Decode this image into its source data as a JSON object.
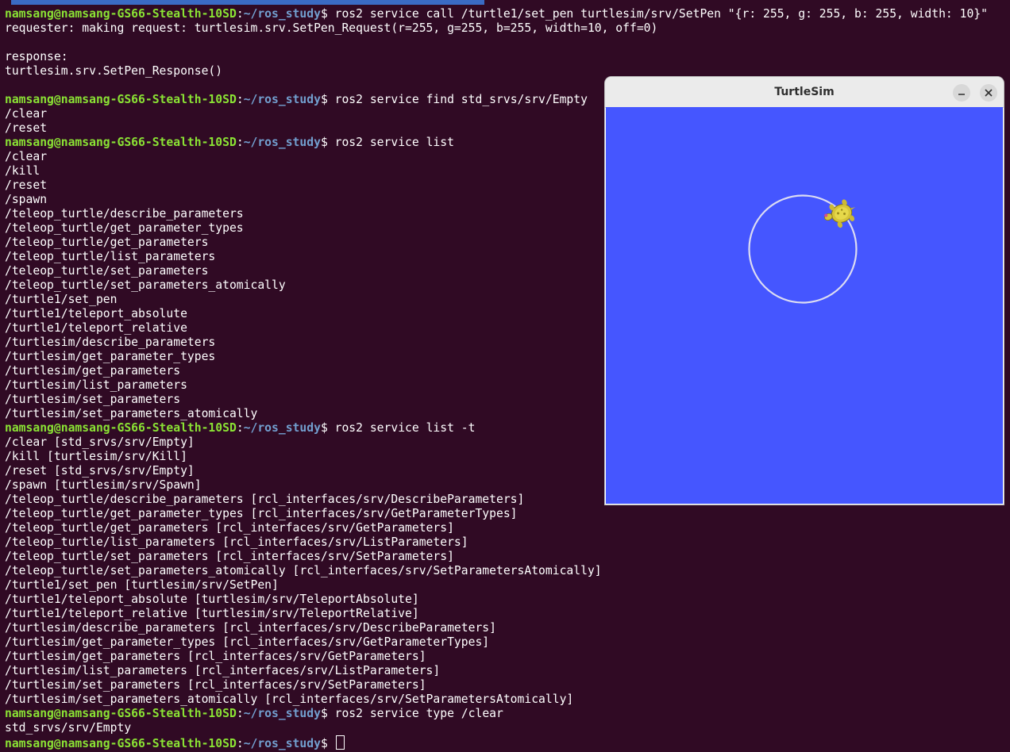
{
  "terminal": {
    "prompt_user": "namsang@namsang-GS66-Stealth-10SD",
    "prompt_path": "~/ros_study",
    "lines": [
      {
        "type": "cmd",
        "text": "ros2 service call /turtle1/set_pen turtlesim/srv/SetPen \"{r: 255, g: 255, b: 255, width: 10}\""
      },
      {
        "type": "out",
        "text": "requester: making request: turtlesim.srv.SetPen_Request(r=255, g=255, b=255, width=10, off=0)"
      },
      {
        "type": "out",
        "text": ""
      },
      {
        "type": "out",
        "text": "response:"
      },
      {
        "type": "out",
        "text": "turtlesim.srv.SetPen_Response()"
      },
      {
        "type": "out",
        "text": ""
      },
      {
        "type": "cmd",
        "text": "ros2 service find std_srvs/srv/Empty"
      },
      {
        "type": "out",
        "text": "/clear"
      },
      {
        "type": "out",
        "text": "/reset"
      },
      {
        "type": "cmd",
        "text": "ros2 service list"
      },
      {
        "type": "out",
        "text": "/clear"
      },
      {
        "type": "out",
        "text": "/kill"
      },
      {
        "type": "out",
        "text": "/reset"
      },
      {
        "type": "out",
        "text": "/spawn"
      },
      {
        "type": "out",
        "text": "/teleop_turtle/describe_parameters"
      },
      {
        "type": "out",
        "text": "/teleop_turtle/get_parameter_types"
      },
      {
        "type": "out",
        "text": "/teleop_turtle/get_parameters"
      },
      {
        "type": "out",
        "text": "/teleop_turtle/list_parameters"
      },
      {
        "type": "out",
        "text": "/teleop_turtle/set_parameters"
      },
      {
        "type": "out",
        "text": "/teleop_turtle/set_parameters_atomically"
      },
      {
        "type": "out",
        "text": "/turtle1/set_pen"
      },
      {
        "type": "out",
        "text": "/turtle1/teleport_absolute"
      },
      {
        "type": "out",
        "text": "/turtle1/teleport_relative"
      },
      {
        "type": "out",
        "text": "/turtlesim/describe_parameters"
      },
      {
        "type": "out",
        "text": "/turtlesim/get_parameter_types"
      },
      {
        "type": "out",
        "text": "/turtlesim/get_parameters"
      },
      {
        "type": "out",
        "text": "/turtlesim/list_parameters"
      },
      {
        "type": "out",
        "text": "/turtlesim/set_parameters"
      },
      {
        "type": "out",
        "text": "/turtlesim/set_parameters_atomically"
      },
      {
        "type": "cmd",
        "text": "ros2 service list -t"
      },
      {
        "type": "out",
        "text": "/clear [std_srvs/srv/Empty]"
      },
      {
        "type": "out",
        "text": "/kill [turtlesim/srv/Kill]"
      },
      {
        "type": "out",
        "text": "/reset [std_srvs/srv/Empty]"
      },
      {
        "type": "out",
        "text": "/spawn [turtlesim/srv/Spawn]"
      },
      {
        "type": "out",
        "text": "/teleop_turtle/describe_parameters [rcl_interfaces/srv/DescribeParameters]"
      },
      {
        "type": "out",
        "text": "/teleop_turtle/get_parameter_types [rcl_interfaces/srv/GetParameterTypes]"
      },
      {
        "type": "out",
        "text": "/teleop_turtle/get_parameters [rcl_interfaces/srv/GetParameters]"
      },
      {
        "type": "out",
        "text": "/teleop_turtle/list_parameters [rcl_interfaces/srv/ListParameters]"
      },
      {
        "type": "out",
        "text": "/teleop_turtle/set_parameters [rcl_interfaces/srv/SetParameters]"
      },
      {
        "type": "out",
        "text": "/teleop_turtle/set_parameters_atomically [rcl_interfaces/srv/SetParametersAtomically]"
      },
      {
        "type": "out",
        "text": "/turtle1/set_pen [turtlesim/srv/SetPen]"
      },
      {
        "type": "out",
        "text": "/turtle1/teleport_absolute [turtlesim/srv/TeleportAbsolute]"
      },
      {
        "type": "out",
        "text": "/turtle1/teleport_relative [turtlesim/srv/TeleportRelative]"
      },
      {
        "type": "out",
        "text": "/turtlesim/describe_parameters [rcl_interfaces/srv/DescribeParameters]"
      },
      {
        "type": "out",
        "text": "/turtlesim/get_parameter_types [rcl_interfaces/srv/GetParameterTypes]"
      },
      {
        "type": "out",
        "text": "/turtlesim/get_parameters [rcl_interfaces/srv/GetParameters]"
      },
      {
        "type": "out",
        "text": "/turtlesim/list_parameters [rcl_interfaces/srv/ListParameters]"
      },
      {
        "type": "out",
        "text": "/turtlesim/set_parameters [rcl_interfaces/srv/SetParameters]"
      },
      {
        "type": "out",
        "text": "/turtlesim/set_parameters_atomically [rcl_interfaces/srv/SetParametersAtomically]"
      },
      {
        "type": "cmd",
        "text": "ros2 service type /clear"
      },
      {
        "type": "out",
        "text": "std_srvs/srv/Empty"
      },
      {
        "type": "prompt",
        "text": ""
      }
    ],
    "colors": {
      "background": "#300a24",
      "user": "#8ae234",
      "path": "#729fcf",
      "text": "#ffffff"
    }
  },
  "turtlesim_window": {
    "title": "TurtleSim",
    "minimize_icon": "minimize-icon",
    "close_icon": "close-icon",
    "canvas_color": "#4556ff",
    "pen_color": "#ffffff"
  }
}
